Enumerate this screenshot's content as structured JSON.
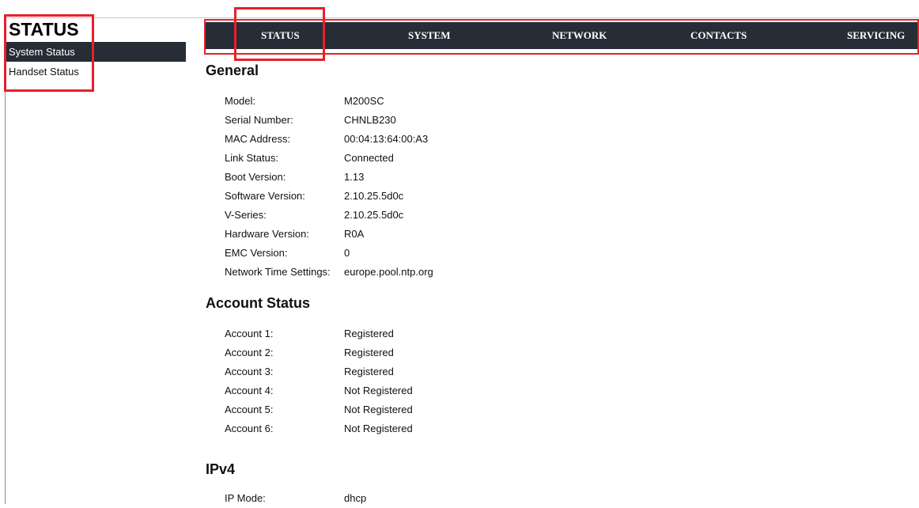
{
  "sidebar": {
    "title": "STATUS",
    "items": [
      {
        "label": "System Status"
      },
      {
        "label": "Handset Status"
      }
    ]
  },
  "nav": {
    "tabs": [
      {
        "label": "STATUS"
      },
      {
        "label": "SYSTEM"
      },
      {
        "label": "NETWORK"
      },
      {
        "label": "CONTACTS"
      },
      {
        "label": "SERVICING"
      }
    ]
  },
  "general": {
    "title": "General",
    "rows": [
      {
        "label": "Model:",
        "value": "M200SC"
      },
      {
        "label": "Serial Number:",
        "value": "CHNLB230"
      },
      {
        "label": "MAC Address:",
        "value": "00:04:13:64:00:A3"
      },
      {
        "label": "Link Status:",
        "value": "Connected"
      },
      {
        "label": "Boot Version:",
        "value": "1.13"
      },
      {
        "label": "Software Version:",
        "value": "2.10.25.5d0c"
      },
      {
        "label": "V-Series:",
        "value": "2.10.25.5d0c"
      },
      {
        "label": "Hardware Version:",
        "value": "R0A"
      },
      {
        "label": "EMC Version:",
        "value": "0"
      },
      {
        "label": "Network Time Settings:",
        "value": "europe.pool.ntp.org"
      }
    ]
  },
  "account_status": {
    "title": "Account Status",
    "rows": [
      {
        "label": "Account 1:",
        "value": "Registered"
      },
      {
        "label": "Account 2:",
        "value": "Registered"
      },
      {
        "label": "Account 3:",
        "value": "Registered"
      },
      {
        "label": "Account 4:",
        "value": "Not Registered"
      },
      {
        "label": "Account 5:",
        "value": "Not Registered"
      },
      {
        "label": "Account 6:",
        "value": "Not Registered"
      }
    ]
  },
  "ipv4": {
    "title": "IPv4",
    "rows": [
      {
        "label": "IP Mode:",
        "value": "dhcp"
      }
    ]
  },
  "colors": {
    "nav_bg": "#262d36",
    "highlight": "#e8202a"
  }
}
